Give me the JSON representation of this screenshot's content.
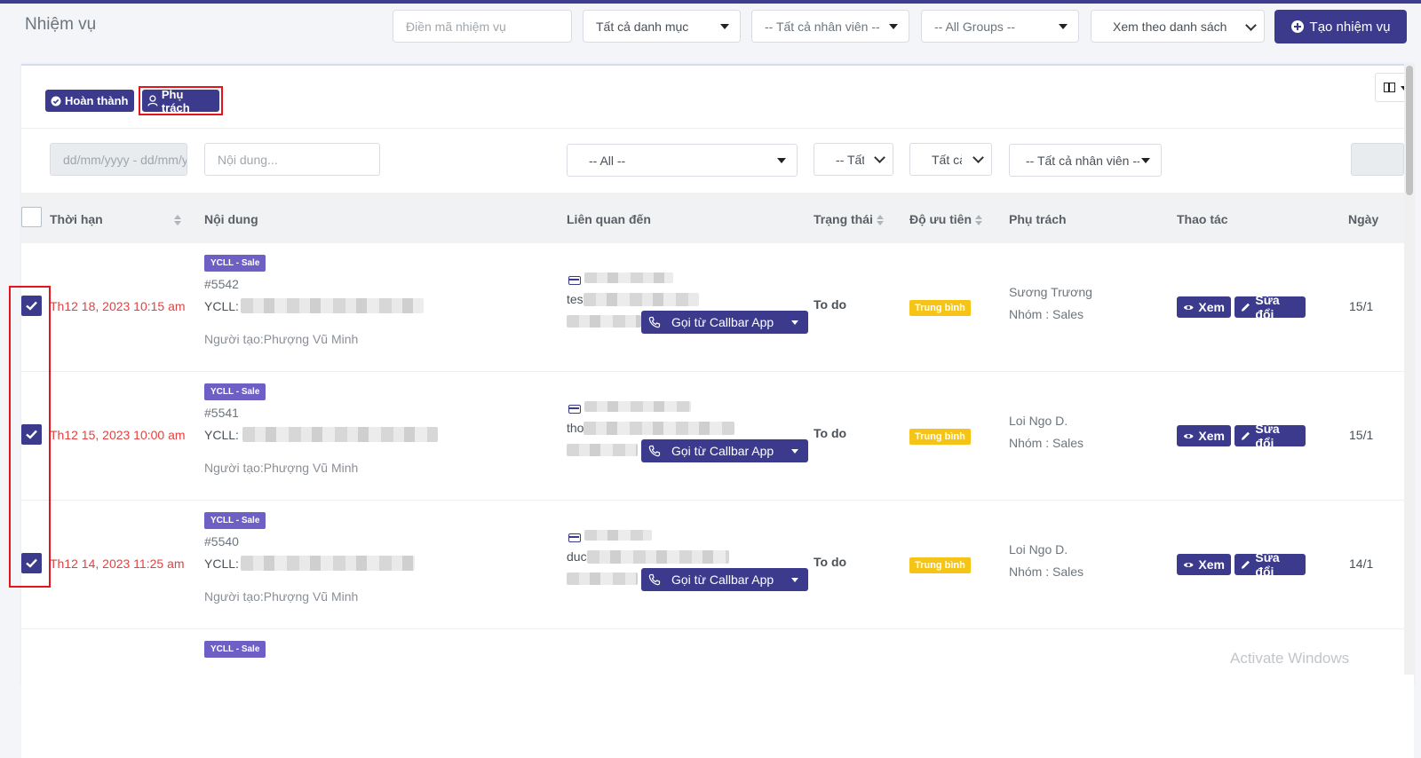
{
  "header": {
    "title": "Nhiệm vụ",
    "task_code_placeholder": "Điền mã nhiệm vụ",
    "category_select": "Tất cả danh mục",
    "employee_select": "-- Tất cả nhân viên --",
    "groups_select": "-- All Groups --",
    "view_select": "Xem theo danh sách",
    "create_button": "Tạo nhiệm vụ"
  },
  "toolbar": {
    "complete_button": "Hoàn thành",
    "assign_button": "Phụ trách"
  },
  "filters": {
    "date_placeholder": "dd/mm/yyyy - dd/mm/yyyy",
    "content_placeholder": "Nội dung...",
    "related_select": "-- All --",
    "status_select": "-- Tất cả --",
    "priority_select": "Tất cả",
    "owner_select": "-- Tất cả nhân viên --"
  },
  "table": {
    "columns": [
      "Thời hạn",
      "Nội dung",
      "Liên quan đến",
      "Trạng thái",
      "Độ ưu tiên",
      "Phụ trách",
      "Thao tác",
      "Ngày"
    ],
    "rows": [
      {
        "checked": true,
        "deadline": "Th12 18, 2023 10:15 am",
        "tag": "YCLL - Sale",
        "id": "#5542",
        "ycll_label": "YCLL:",
        "creator": "Người tạo:Phượng Vũ Minh",
        "related_prefix": "tes",
        "call_button": "Gọi từ Callbar App",
        "status": "To do",
        "priority": "Trung bình",
        "owner": "Sương Trương",
        "team": "Nhóm : Sales",
        "view_button": "Xem",
        "edit_button": "Sửa đổi",
        "date": "15/1"
      },
      {
        "checked": true,
        "deadline": "Th12 15, 2023 10:00 am",
        "tag": "YCLL - Sale",
        "id": "#5541",
        "ycll_label": "YCLL:",
        "creator": "Người tạo:Phượng Vũ Minh",
        "related_prefix": "tho",
        "call_button": "Gọi từ Callbar App",
        "status": "To do",
        "priority": "Trung bình",
        "owner": "Loi Ngo D.",
        "team": "Nhóm : Sales",
        "view_button": "Xem",
        "edit_button": "Sửa đổi",
        "date": "15/1"
      },
      {
        "checked": true,
        "deadline": "Th12 14, 2023 11:25 am",
        "tag": "YCLL - Sale",
        "id": "#5540",
        "ycll_label": "YCLL:",
        "creator": "Người tạo:Phượng Vũ Minh",
        "related_prefix": "duc",
        "call_button": "Gọi từ Callbar App",
        "status": "To do",
        "priority": "Trung bình",
        "owner": "Loi Ngo D.",
        "team": "Nhóm : Sales",
        "view_button": "Xem",
        "edit_button": "Sửa đổi",
        "date": "14/1"
      }
    ],
    "partial_row_tag": "YCLL - Sale"
  },
  "watermark": "Activate Windows",
  "colors": {
    "primary": "#3b3a8c",
    "tag": "#6d5fc4",
    "priority": "#f6c417",
    "deadline": "#e3413f",
    "highlight": "#e5141b"
  }
}
